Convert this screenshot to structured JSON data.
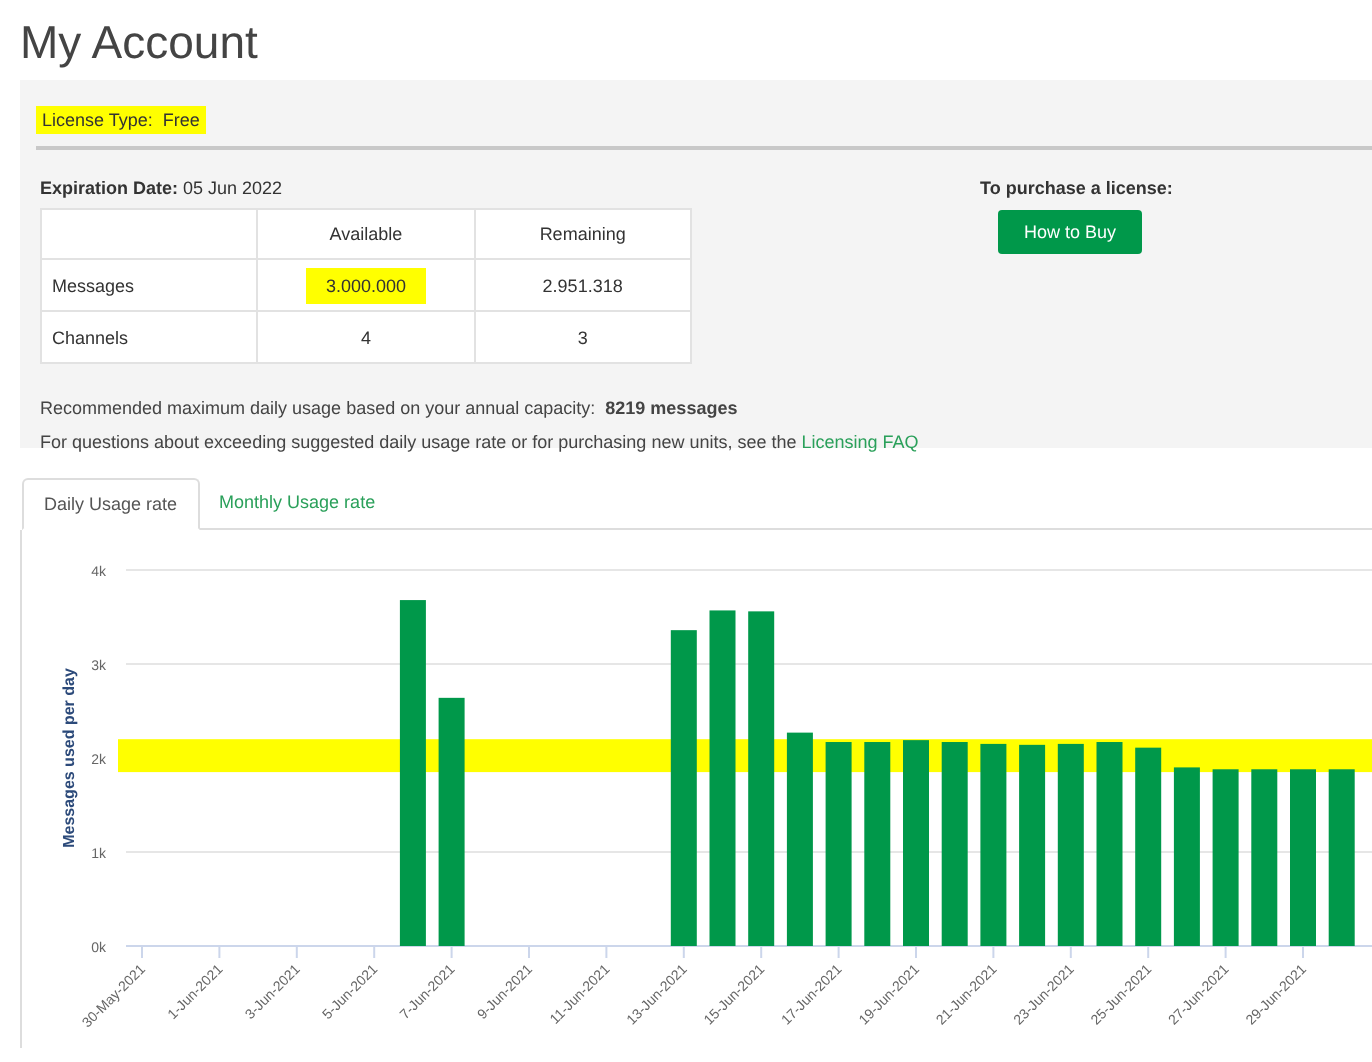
{
  "page_title": "My Account",
  "license": {
    "label": "License Type:",
    "value": "Free",
    "highlighted": true
  },
  "expiration": {
    "label": "Expiration Date:",
    "value": "05 Jun 2022"
  },
  "table": {
    "columns": [
      "",
      "Available",
      "Remaining"
    ],
    "rows": [
      {
        "cells": [
          {
            "text": "Messages",
            "highlighted": false
          },
          {
            "text": "3.000.000",
            "highlighted": true
          },
          {
            "text": "2.951.318",
            "highlighted": false
          }
        ]
      },
      {
        "cells": [
          {
            "text": "Channels",
            "highlighted": false
          },
          {
            "text": "4",
            "highlighted": false
          },
          {
            "text": "3",
            "highlighted": false
          }
        ]
      }
    ]
  },
  "purchase": {
    "label": "To purchase a license:",
    "button": "How to Buy"
  },
  "recommendation": {
    "text": "Recommended maximum daily usage based on your annual capacity:",
    "value": "8219 messages"
  },
  "faq": {
    "text": "For questions about exceeding suggested daily usage rate or for purchasing new units, see the",
    "link": "Licensing FAQ"
  },
  "tabs": [
    {
      "label": "Daily Usage rate",
      "selected": true
    },
    {
      "label": "Monthly Usage rate",
      "selected": false
    }
  ],
  "chart_data": {
    "type": "bar",
    "ylabel": "Messages used per day",
    "categories": [
      "30-May-2021",
      null,
      "1-Jun-2021",
      null,
      "3-Jun-2021",
      null,
      "5-Jun-2021",
      null,
      "7-Jun-2021",
      null,
      "9-Jun-2021",
      null,
      "11-Jun-2021",
      null,
      "13-Jun-2021",
      null,
      "15-Jun-2021",
      null,
      "17-Jun-2021",
      null,
      "19-Jun-2021",
      null,
      "21-Jun-2021",
      null,
      "23-Jun-2021",
      null,
      "25-Jun-2021",
      null,
      "27-Jun-2021",
      null,
      "29-Jun-2021",
      null
    ],
    "grid": true,
    "bands": [
      {
        "axis": "y",
        "from": 1850,
        "to": 2200,
        "color": "#ffff00"
      }
    ],
    "ylim": [
      0,
      4000
    ],
    "yticks": [
      {
        "value": 0,
        "label": "0k"
      },
      {
        "value": 1000,
        "label": "1k"
      },
      {
        "value": 2000,
        "label": "2k"
      },
      {
        "value": 3000,
        "label": "3k"
      },
      {
        "value": 4000,
        "label": "4k"
      }
    ],
    "series": [
      {
        "color": "#00984a",
        "values": [
          0,
          0,
          0,
          0,
          0,
          0,
          0,
          3680,
          2640,
          0,
          0,
          0,
          0,
          0,
          3360,
          3570,
          3560,
          2270,
          2170,
          2170,
          2190,
          2170,
          2150,
          2140,
          2150,
          2170,
          2110,
          1900,
          1880,
          1880,
          1880,
          1880
        ]
      }
    ]
  }
}
